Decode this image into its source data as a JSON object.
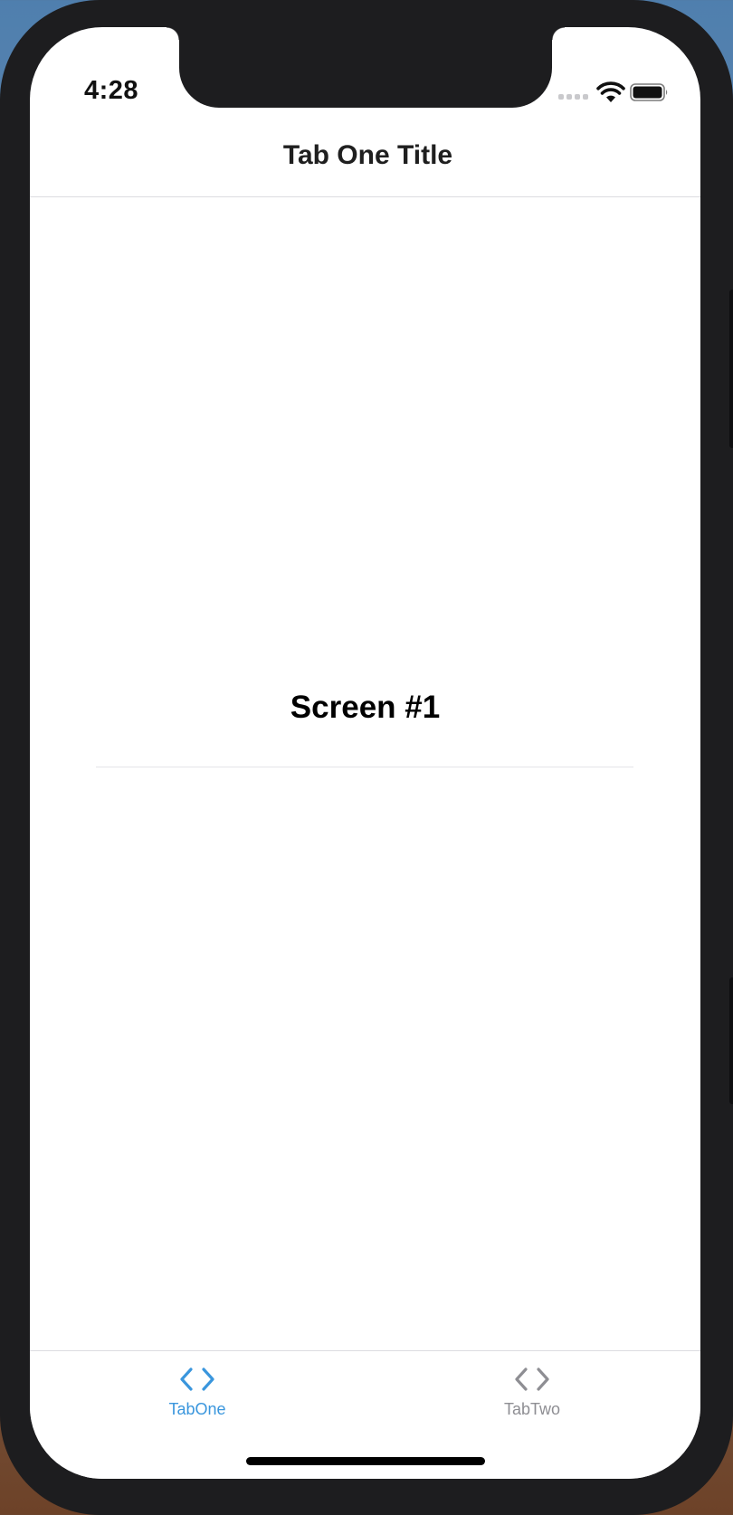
{
  "status_bar": {
    "time": "4:28",
    "signal_icon": "signal-dots-icon",
    "wifi_icon": "wifi-icon",
    "battery_icon": "battery-icon"
  },
  "nav": {
    "title": "Tab One Title"
  },
  "content": {
    "title": "Screen #1"
  },
  "tabs": [
    {
      "label": "TabOne",
      "icon": "code-icon",
      "active": true
    },
    {
      "label": "TabTwo",
      "icon": "code-icon",
      "active": false
    }
  ],
  "colors": {
    "active_tab": "#3a96dd",
    "inactive_tab": "#8e8e93"
  }
}
